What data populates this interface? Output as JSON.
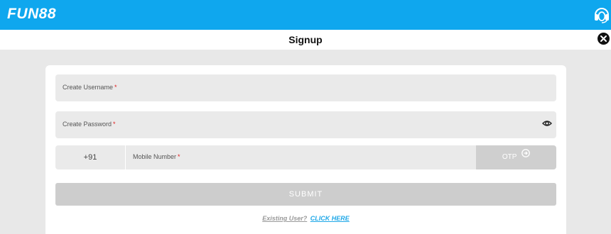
{
  "header": {
    "logo_text": "FUN88",
    "brand_color": "#0fa7ee",
    "support_icon": "headset-icon"
  },
  "modal": {
    "title": "Signup",
    "close_icon": "close-icon"
  },
  "form": {
    "username_label": "Create Username",
    "password_label": "Create Password",
    "required_mark": "*",
    "country_code": "+91",
    "mobile_label": "Mobile Number",
    "otp_label": "OTP",
    "submit_label": "SUBMIT",
    "existing_user_text": "Existing User?",
    "click_here_text": "CLICK HERE"
  }
}
